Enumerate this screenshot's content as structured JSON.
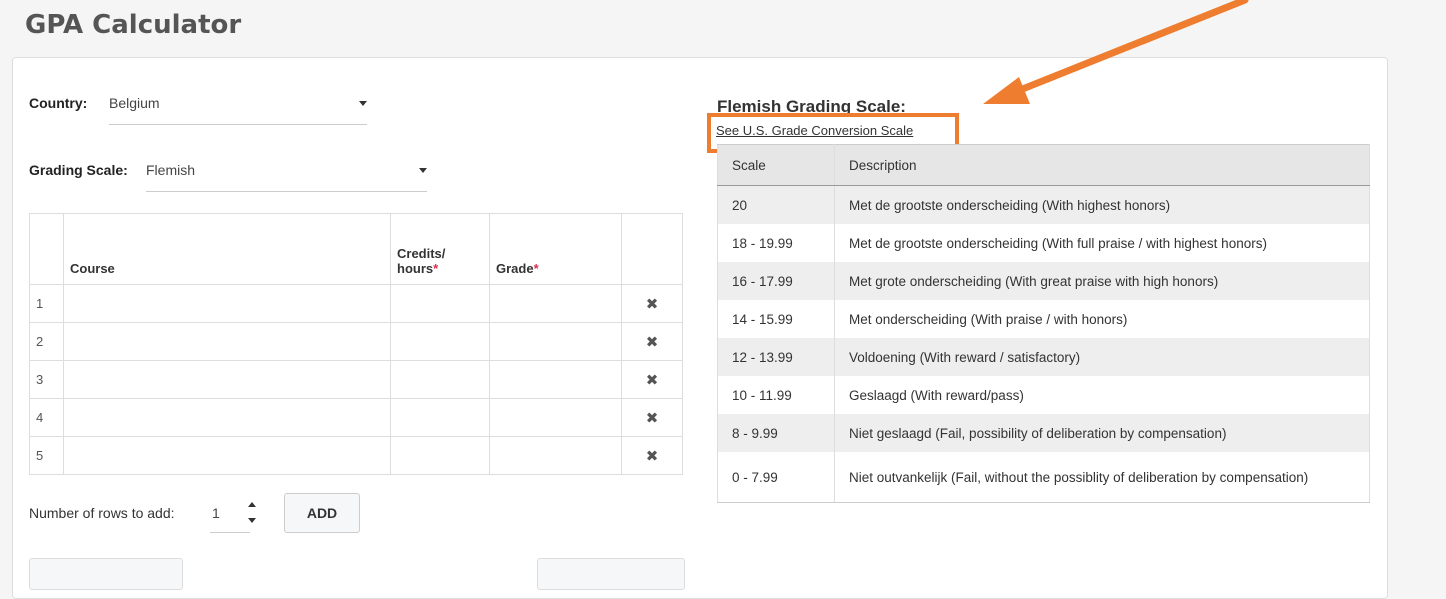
{
  "page": {
    "title": "GPA Calculator"
  },
  "country": {
    "label": "Country:",
    "value": "Belgium"
  },
  "grading_scale": {
    "label": "Grading Scale:",
    "value": "Flemish"
  },
  "course_table": {
    "headers": {
      "course": "Course",
      "credits": "Credits/ hours",
      "grade": "Grade",
      "required_mark": "*"
    },
    "rows": [
      {
        "num": "1",
        "course": "",
        "credits": "",
        "grade": ""
      },
      {
        "num": "2",
        "course": "",
        "credits": "",
        "grade": ""
      },
      {
        "num": "3",
        "course": "",
        "credits": "",
        "grade": ""
      },
      {
        "num": "4",
        "course": "",
        "credits": "",
        "grade": ""
      },
      {
        "num": "5",
        "course": "",
        "credits": "",
        "grade": ""
      }
    ],
    "remove_icon": "✖"
  },
  "add_rows": {
    "label": "Number of rows to add:",
    "value": "1",
    "button": "ADD"
  },
  "scale_panel": {
    "title": "Flemish Grading Scale:",
    "link": "See U.S. Grade Conversion Scale",
    "headers": {
      "scale": "Scale",
      "description": "Description"
    },
    "rows": [
      {
        "scale": "20",
        "description": "Met de grootste onderscheiding (With highest honors)"
      },
      {
        "scale": "18 - 19.99",
        "description": "Met de grootste onderscheiding (With full praise / with highest honors)"
      },
      {
        "scale": "16 - 17.99",
        "description": "Met grote onderscheiding (With great praise with high honors)"
      },
      {
        "scale": "14 - 15.99",
        "description": "Met onderscheiding (With praise / with honors)"
      },
      {
        "scale": "12 - 13.99",
        "description": "Voldoening (With reward / satisfactory)"
      },
      {
        "scale": "10 - 11.99",
        "description": "Geslaagd (With reward/pass)"
      },
      {
        "scale": "8 - 9.99",
        "description": "Niet geslaagd (Fail, possibility of deliberation by compensation)"
      },
      {
        "scale": "0 - 7.99",
        "description": "Niet outvankelijk (Fail, without the possiblity of deliberation by compensation)"
      }
    ]
  },
  "annotation": {
    "color": "#ef7d2f"
  }
}
